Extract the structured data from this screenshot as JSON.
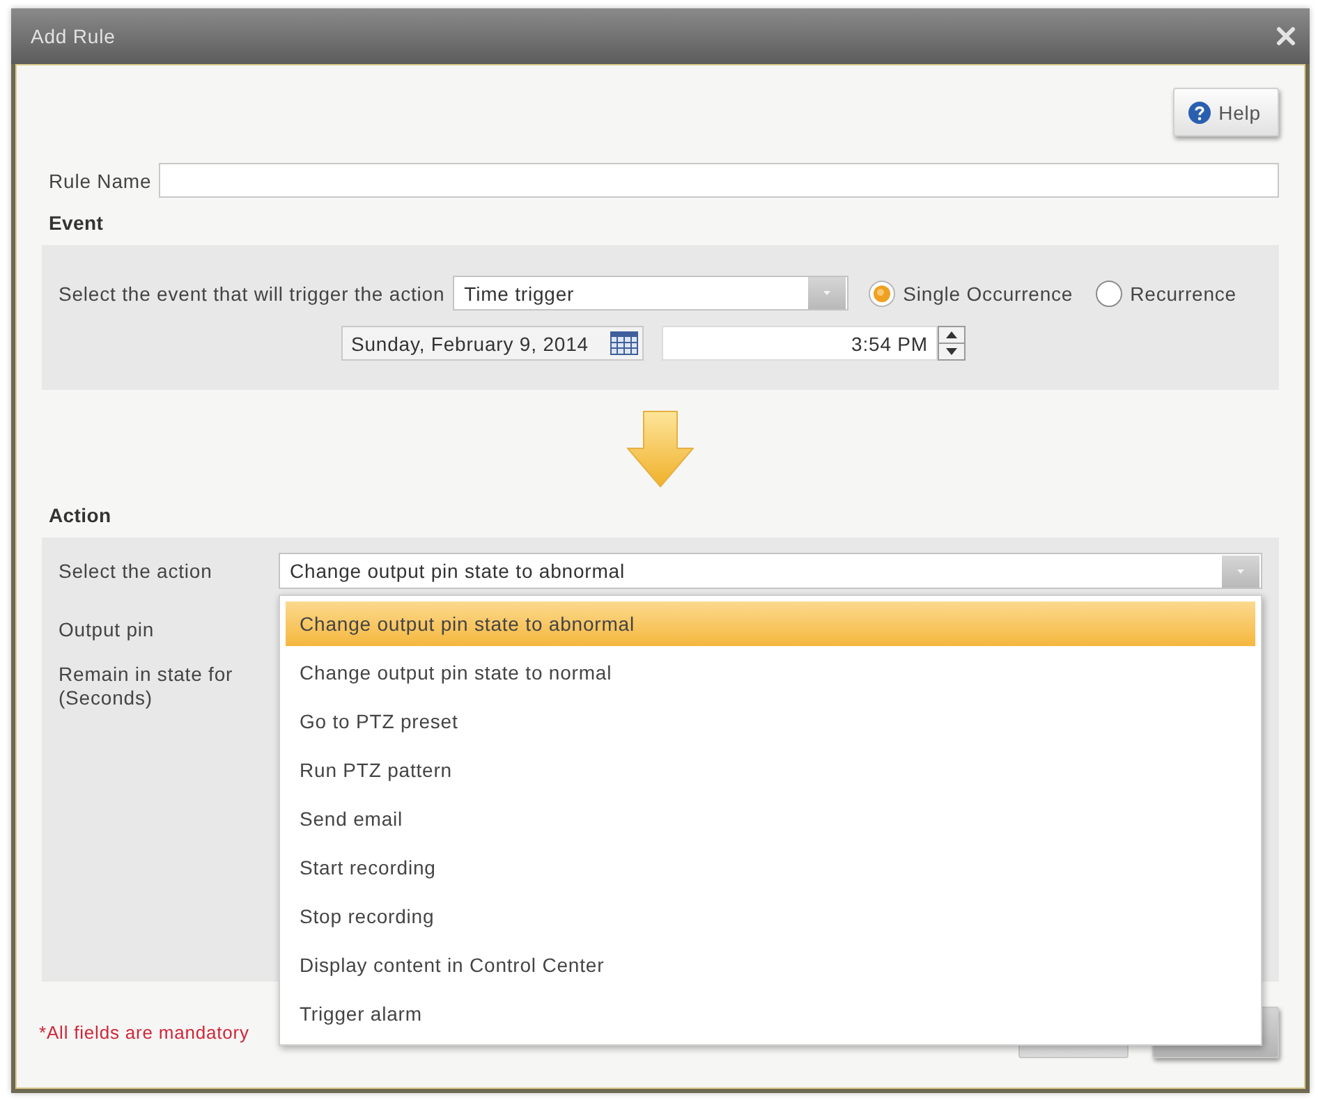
{
  "window": {
    "title": "Add Rule"
  },
  "help_button": {
    "label": "Help"
  },
  "rule_name": {
    "label": "Rule Name"
  },
  "event": {
    "heading": "Event",
    "trigger_label": "Select the event that will trigger the action",
    "trigger_value": "Time trigger",
    "occurrence": [
      {
        "label": "Single Occurrence",
        "selected": true
      },
      {
        "label": "Recurrence",
        "selected": false
      }
    ],
    "date": "Sunday, February 9, 2014",
    "time": "3:54 PM"
  },
  "action": {
    "heading": "Action",
    "select_label": "Select the action",
    "select_value": "Change output pin state to abnormal",
    "fields": [
      {
        "label": "Output pin"
      },
      {
        "label": "Remain in state for (Seconds)"
      }
    ],
    "menu": {
      "items": [
        {
          "label": "Change output pin state to abnormal",
          "selected": true
        },
        {
          "label": "Change output pin state to normal",
          "selected": false
        },
        {
          "label": "Go to PTZ preset",
          "selected": false
        },
        {
          "label": "Run PTZ pattern",
          "selected": false
        },
        {
          "label": "Send email",
          "selected": false
        },
        {
          "label": "Start recording",
          "selected": false
        },
        {
          "label": "Stop recording",
          "selected": false
        },
        {
          "label": "Display content in Control Center",
          "selected": false
        },
        {
          "label": "Trigger alarm",
          "selected": false
        }
      ]
    }
  },
  "footer": {
    "note": "*All fields are mandatory",
    "buttons": [
      {
        "kind": "secondary"
      },
      {
        "kind": "primary"
      }
    ]
  }
}
